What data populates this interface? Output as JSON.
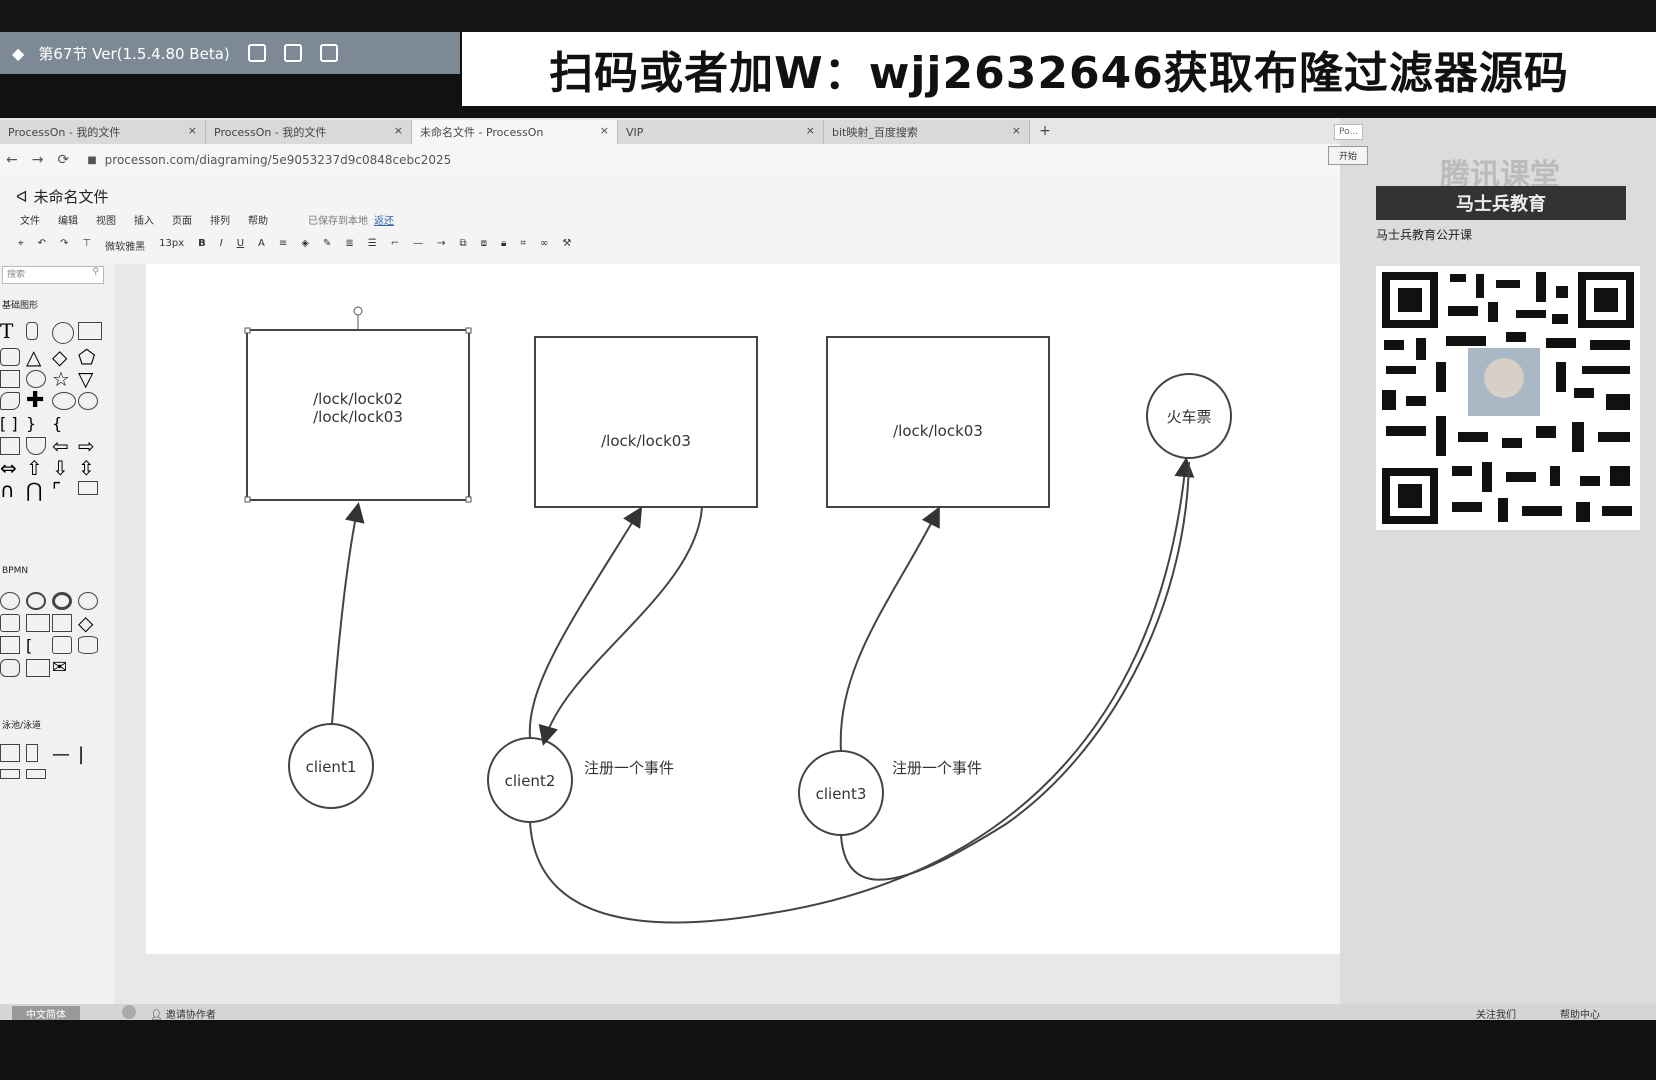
{
  "player": {
    "title": "第67节 Ver(1.5.4.80 Beta)"
  },
  "banner": {
    "text": "扫码或者加W：wjj2632646获取布隆过滤器源码"
  },
  "browser": {
    "tabs": [
      {
        "label": "ProcessOn - 我的文件",
        "close": "×"
      },
      {
        "label": "ProcessOn - 我的文件",
        "close": "×"
      },
      {
        "label": "未命名文件 - ProcessOn",
        "close": "×"
      },
      {
        "label": "VIP",
        "close": "×"
      },
      {
        "label": "bit映射_百度搜索",
        "close": "×"
      }
    ],
    "new_tab": "+",
    "url": "processon.com/diagraming/5e9053237d9c0848cebc2025",
    "side_tab": "Po..."
  },
  "app": {
    "file_title": "未命名文件",
    "menu": [
      "文件",
      "编辑",
      "视图",
      "插入",
      "页面",
      "排列",
      "帮助"
    ],
    "save_status": "已保存到本地",
    "save_action": "返还",
    "toolbar": {
      "font": "微软雅黑",
      "size": "13px",
      "bold": "B",
      "italic": "I",
      "underline": "U",
      "font_color": "A"
    },
    "sidebar": {
      "search_placeholder": "搜索",
      "sections": [
        "基础图形",
        "BPMN",
        "泳池/泳道"
      ],
      "text_tool": "T"
    }
  },
  "diagram": {
    "boxes": [
      {
        "line1": "/lock/lock02",
        "line2": "/lock/lock03"
      },
      {
        "line1": "/lock/lock03"
      },
      {
        "line1": "/lock/lock03"
      }
    ],
    "target_circle": "火车票",
    "clients": [
      "client1",
      "client2",
      "client3"
    ],
    "annotations": [
      "注册一个事件",
      "注册一个事件"
    ]
  },
  "right_panel": {
    "watermark": "腾讯课堂",
    "brand": "马士兵教育",
    "course": "马士兵教育公开课",
    "start_button": "开始"
  },
  "statusbar": {
    "left": "中文简体",
    "invite": "邀请协作者",
    "follow": "关注我们",
    "help": "帮助中心"
  }
}
